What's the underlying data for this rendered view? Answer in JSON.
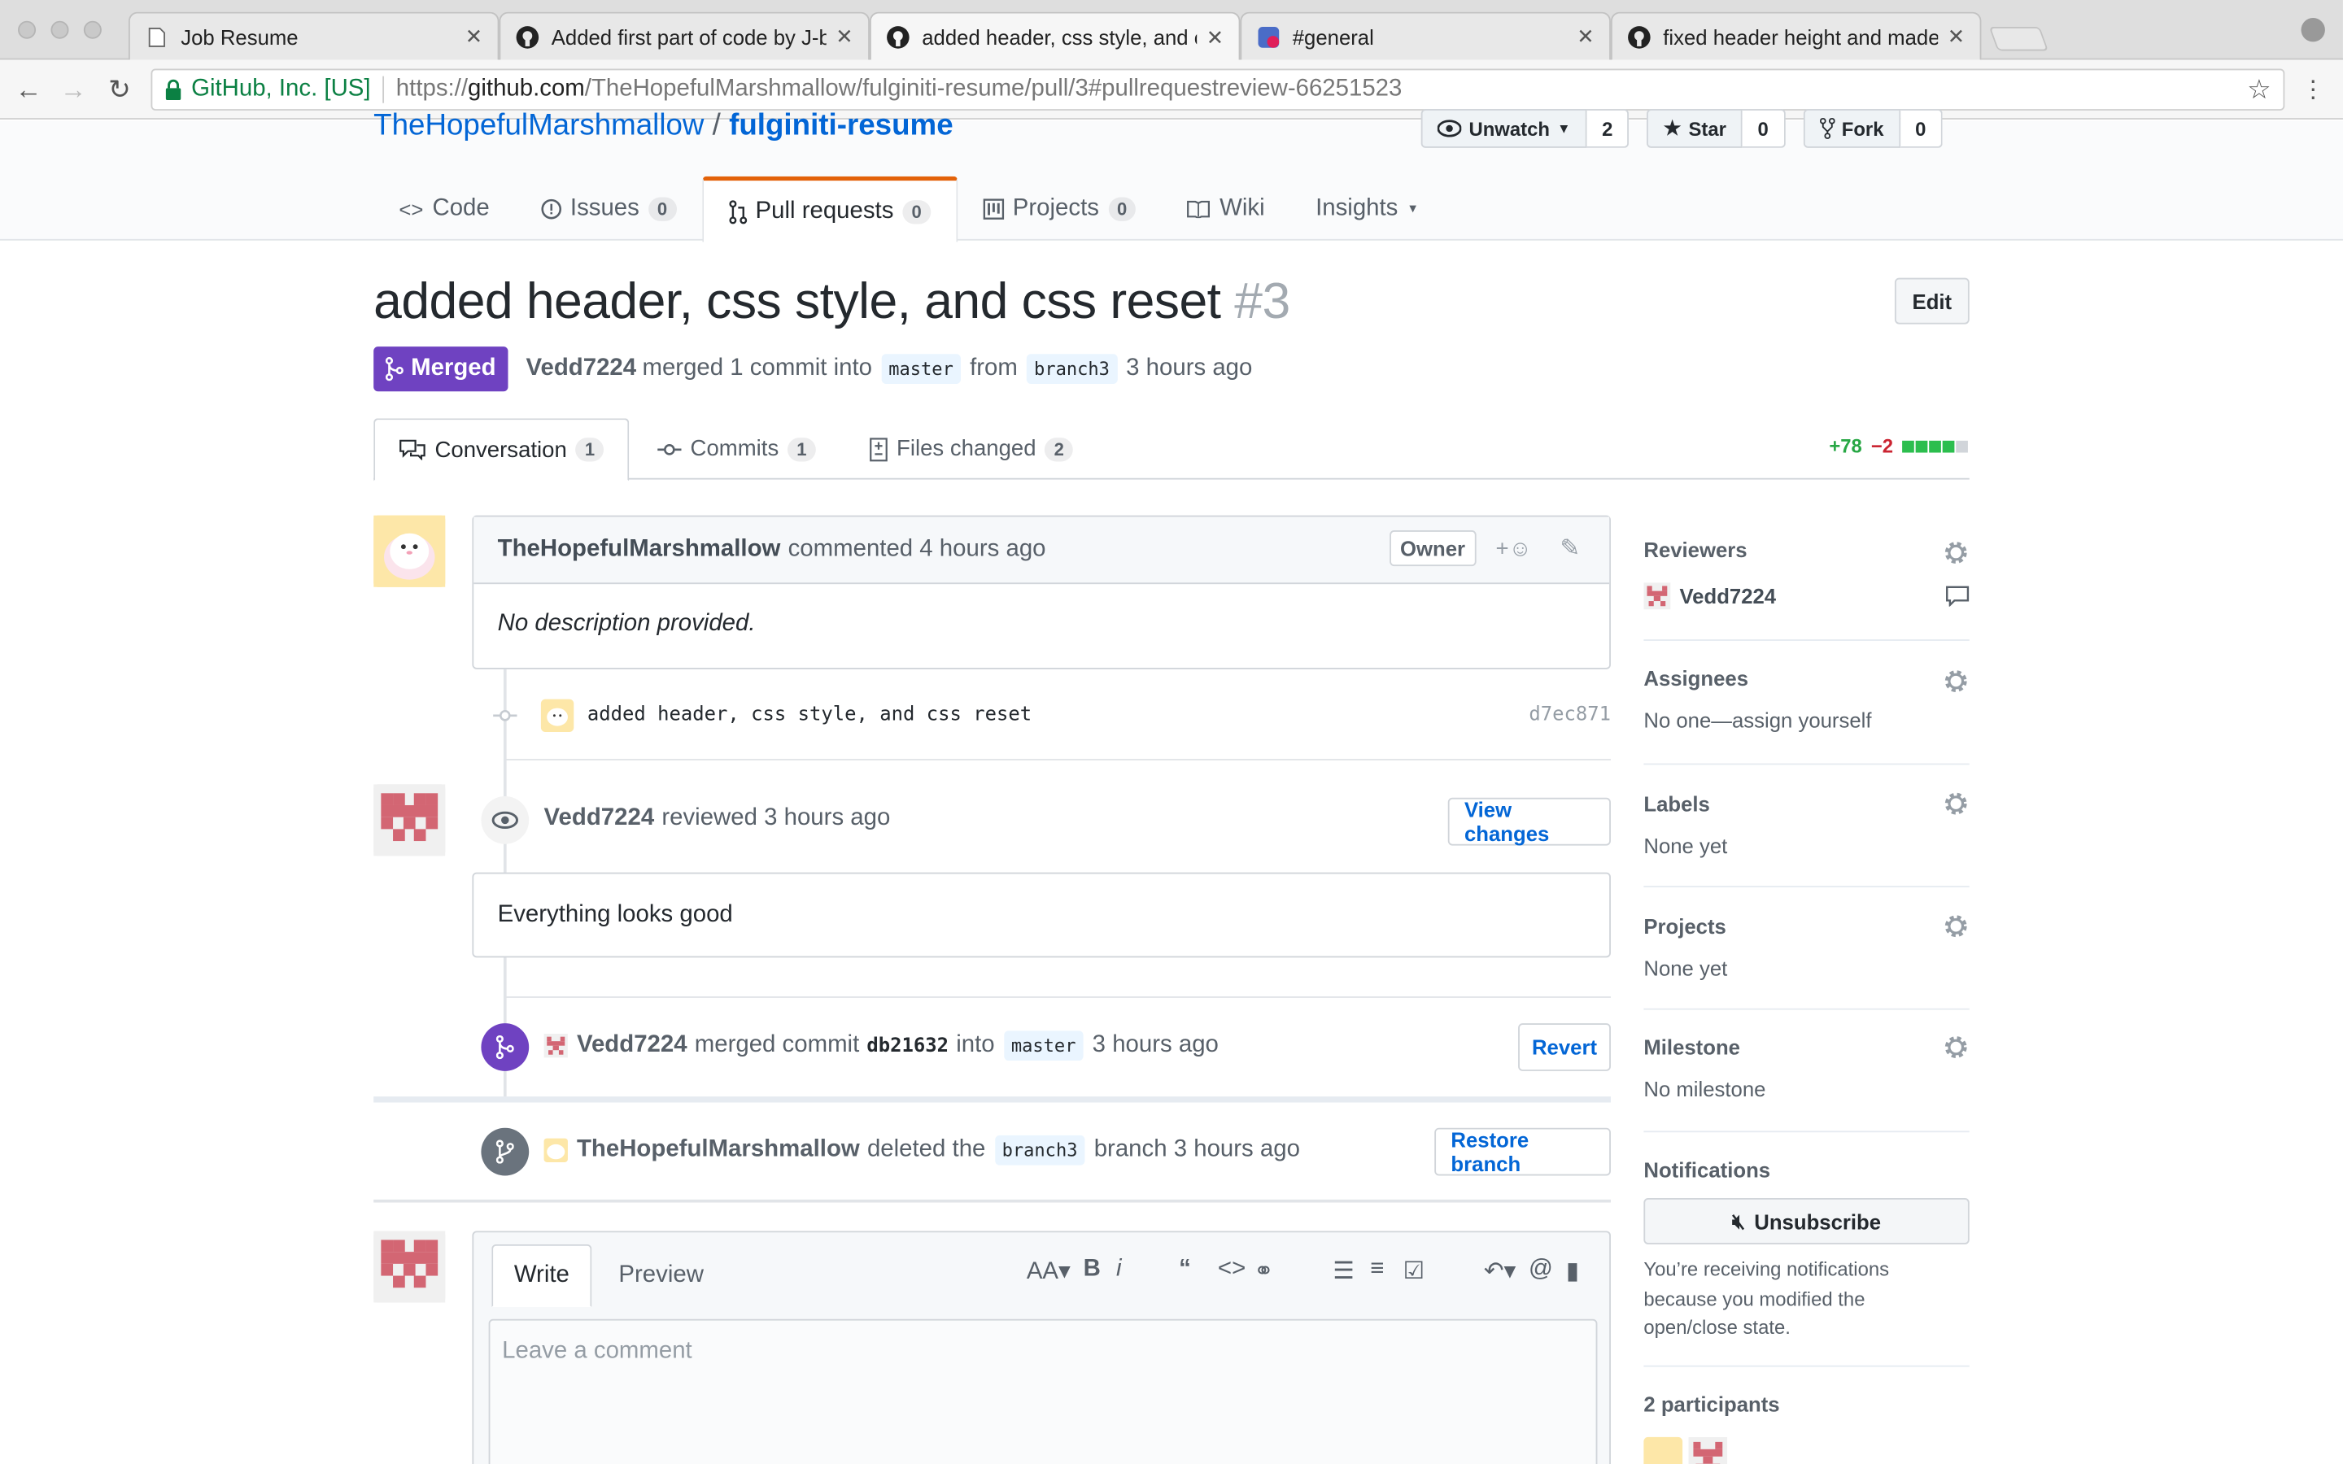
{
  "browser": {
    "tabs": [
      {
        "title": "Job Resume",
        "icon": "file-icon"
      },
      {
        "title": "Added first part of code by J-b",
        "icon": "github-icon"
      },
      {
        "title": "added header, css style, and c",
        "icon": "github-icon"
      },
      {
        "title": "#general",
        "icon": "slack-icon"
      },
      {
        "title": "fixed header height and made",
        "icon": "github-icon"
      }
    ],
    "secure_label": "GitHub, Inc. [US]",
    "url_scheme": "https://",
    "url_host": "github.com",
    "url_path": "/TheHopefulMarshmallow/fulginiti-resume/pull/3#pullrequestreview-66251523"
  },
  "repo": {
    "owner": "TheHopefulMarshmallow",
    "sep": "/",
    "name": "fulginiti-resume",
    "unwatch_label": "Unwatch",
    "watch_count": "2",
    "star_label": "Star",
    "star_count": "0",
    "fork_label": "Fork",
    "fork_count": "0",
    "nav": {
      "code": "Code",
      "issues": "Issues",
      "issues_count": "0",
      "pulls": "Pull requests",
      "pulls_count": "0",
      "projects": "Projects",
      "projects_count": "0",
      "wiki": "Wiki",
      "insights": "Insights"
    }
  },
  "pr": {
    "title": "added header, css style, and css reset",
    "number": "#3",
    "edit_label": "Edit",
    "state": "Merged",
    "author": "Vedd7224",
    "meta_1": "merged 1 commit into",
    "base_branch": "master",
    "meta_2": "from",
    "head_branch": "branch3",
    "meta_3": "3 hours ago",
    "tabs": {
      "conversation": "Conversation",
      "conversation_count": "1",
      "commits": "Commits",
      "commits_count": "1",
      "files": "Files changed",
      "files_count": "2"
    },
    "additions": "+78",
    "deletions": "−2"
  },
  "timeline": {
    "comment_author": "TheHopefulMarshmallow",
    "comment_action": "commented 4 hours ago",
    "owner_badge": "Owner",
    "comment_body": "No description provided.",
    "commit_message": "added header, css style, and css reset",
    "commit_sha": "d7ec871",
    "review_author": "Vedd7224",
    "review_action": "reviewed 3 hours ago",
    "view_changes": "View changes",
    "review_body": "Everything looks good",
    "merge_author": "Vedd7224",
    "merge_text_1": "merged commit",
    "merge_sha": "db21632",
    "merge_text_2": "into",
    "merge_branch": "master",
    "merge_time": "3 hours ago",
    "revert_label": "Revert",
    "delete_author": "TheHopefulMarshmallow",
    "delete_text_1": "deleted the",
    "delete_branch": "branch3",
    "delete_text_2": "branch 3 hours ago",
    "restore_label": "Restore branch"
  },
  "new_comment": {
    "write_tab": "Write",
    "preview_tab": "Preview",
    "placeholder": "Leave a comment"
  },
  "sidebar": {
    "reviewers_h": "Reviewers",
    "reviewer": "Vedd7224",
    "assignees_h": "Assignees",
    "assignees_v": "No one—assign yourself",
    "labels_h": "Labels",
    "labels_v": "None yet",
    "projects_h": "Projects",
    "projects_v": "None yet",
    "milestone_h": "Milestone",
    "milestone_v": "No milestone",
    "notifications_h": "Notifications",
    "unsubscribe": "Unsubscribe",
    "notif_text_1": "You’re receiving notifications",
    "notif_text_2": "because you modified the",
    "notif_text_3": "open/close state.",
    "participants_h": "2 participants"
  },
  "colors": {
    "merged": "#6f42c1",
    "link": "#0366d6",
    "addition": "#28a745",
    "deletion": "#cb2431",
    "nav_accent": "#e36209"
  }
}
